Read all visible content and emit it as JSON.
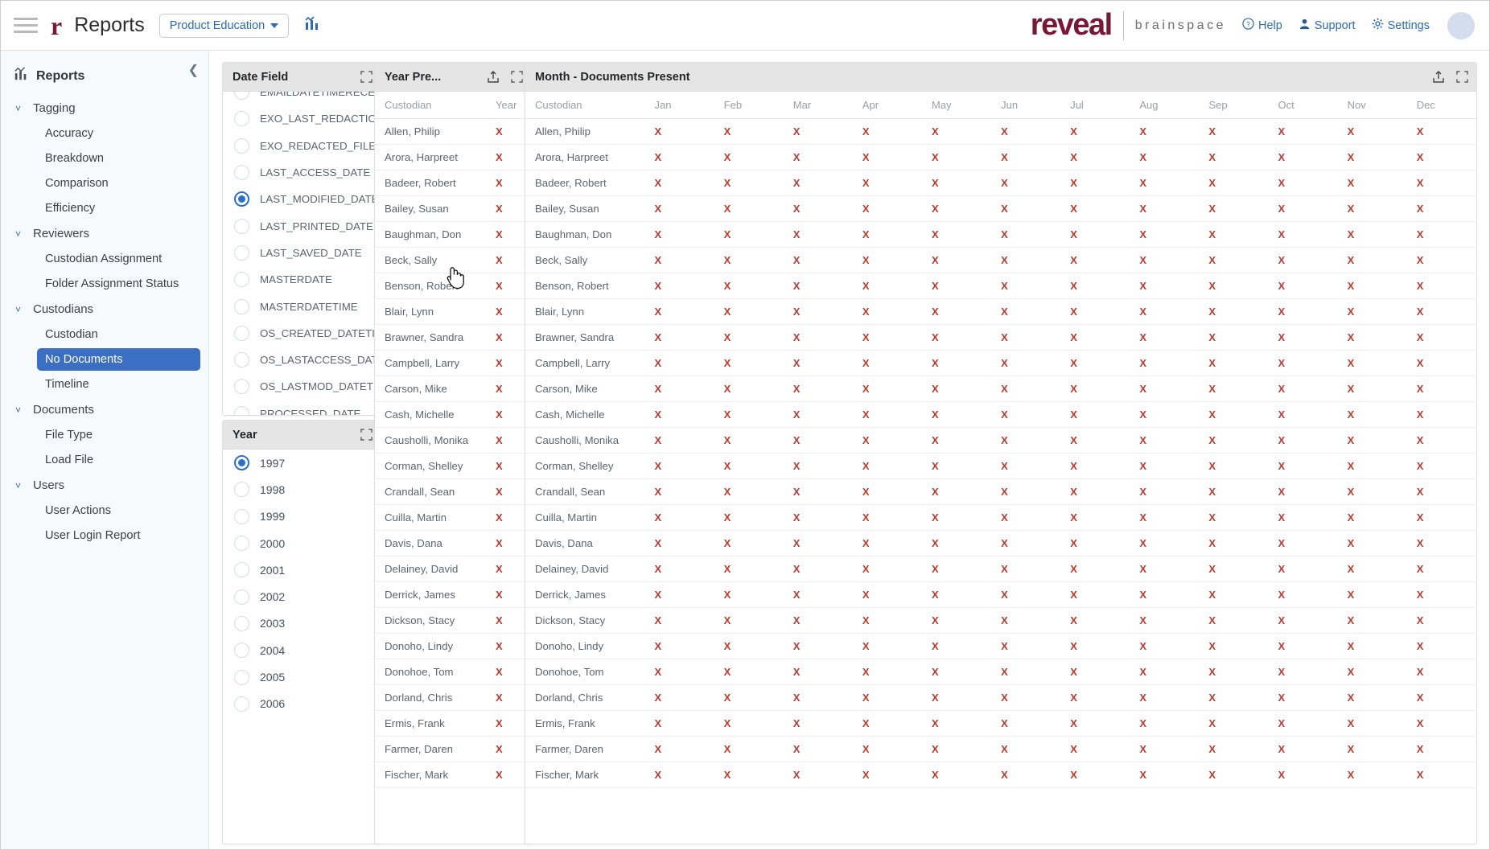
{
  "header": {
    "app_title": "Reports",
    "project_selector": "Product Education",
    "logo_primary": "reveal",
    "logo_secondary": "brainspace",
    "links": [
      {
        "label": "Help",
        "icon": "help-circle-icon"
      },
      {
        "label": "Support",
        "icon": "support-person-icon"
      },
      {
        "label": "Settings",
        "icon": "gear-icon"
      }
    ],
    "accent_color": "#7b1736",
    "link_color": "#2b6cb8"
  },
  "sidebar": {
    "title": "Reports",
    "groups": [
      {
        "label": "Tagging",
        "items": [
          "Accuracy",
          "Breakdown",
          "Comparison",
          "Efficiency"
        ]
      },
      {
        "label": "Reviewers",
        "items": [
          "Custodian Assignment",
          "Folder Assignment Status"
        ]
      },
      {
        "label": "Custodians",
        "items": [
          "Custodian",
          "No Documents",
          "Timeline"
        ]
      },
      {
        "label": "Documents",
        "items": [
          "File Type",
          "Load File"
        ]
      },
      {
        "label": "Users",
        "items": [
          "User Actions",
          "User Login Report"
        ]
      }
    ],
    "active_item": "No Documents",
    "active_color": "#3b6fc4"
  },
  "date_field_panel": {
    "title": "Date Field",
    "selected": "LAST_MODIFIED_DATE",
    "options": [
      "EMAILDATETIMERECEIVED",
      "EXO_LAST_REDACTION_M...",
      "EXO_REDACTED_FILE_CR...",
      "LAST_ACCESS_DATE",
      "LAST_MODIFIED_DATE",
      "LAST_PRINTED_DATE",
      "LAST_SAVED_DATE",
      "MASTERDATE",
      "MASTERDATETIME",
      "OS_CREATED_DATETIME",
      "OS_LASTACCESS_DATETIME",
      "OS_LASTMOD_DATETIME",
      "PROCESSED_DATE"
    ]
  },
  "year_panel": {
    "title": "Year",
    "selected": "1997",
    "options": [
      "1997",
      "1998",
      "1999",
      "2000",
      "2001",
      "2002",
      "2003",
      "2004",
      "2005",
      "2006"
    ]
  },
  "year_present_panel": {
    "title": "Year Pre...",
    "columns": [
      "Custodian",
      "Year"
    ],
    "mark": "X"
  },
  "month_panel": {
    "title": "Month - Documents Present",
    "columns": [
      "Custodian",
      "Jan",
      "Feb",
      "Mar",
      "Apr",
      "May",
      "Jun",
      "Jul",
      "Aug",
      "Sep",
      "Oct",
      "Nov",
      "Dec"
    ],
    "mark": "X"
  },
  "custodians": [
    "Allen, Philip",
    "Arora, Harpreet",
    "Badeer, Robert",
    "Bailey, Susan",
    "Baughman, Don",
    "Beck, Sally",
    "Benson, Robert",
    "Blair, Lynn",
    "Brawner, Sandra",
    "Campbell, Larry",
    "Carson, Mike",
    "Cash, Michelle",
    "Causholli, Monika",
    "Corman, Shelley",
    "Crandall, Sean",
    "Cuilla, Martin",
    "Davis, Dana",
    "Delainey, David",
    "Derrick, James",
    "Dickson, Stacy",
    "Donoho, Lindy",
    "Donohoe, Tom",
    "Dorland, Chris",
    "Ermis, Frank",
    "Farmer, Daren",
    "Fischer, Mark"
  ]
}
